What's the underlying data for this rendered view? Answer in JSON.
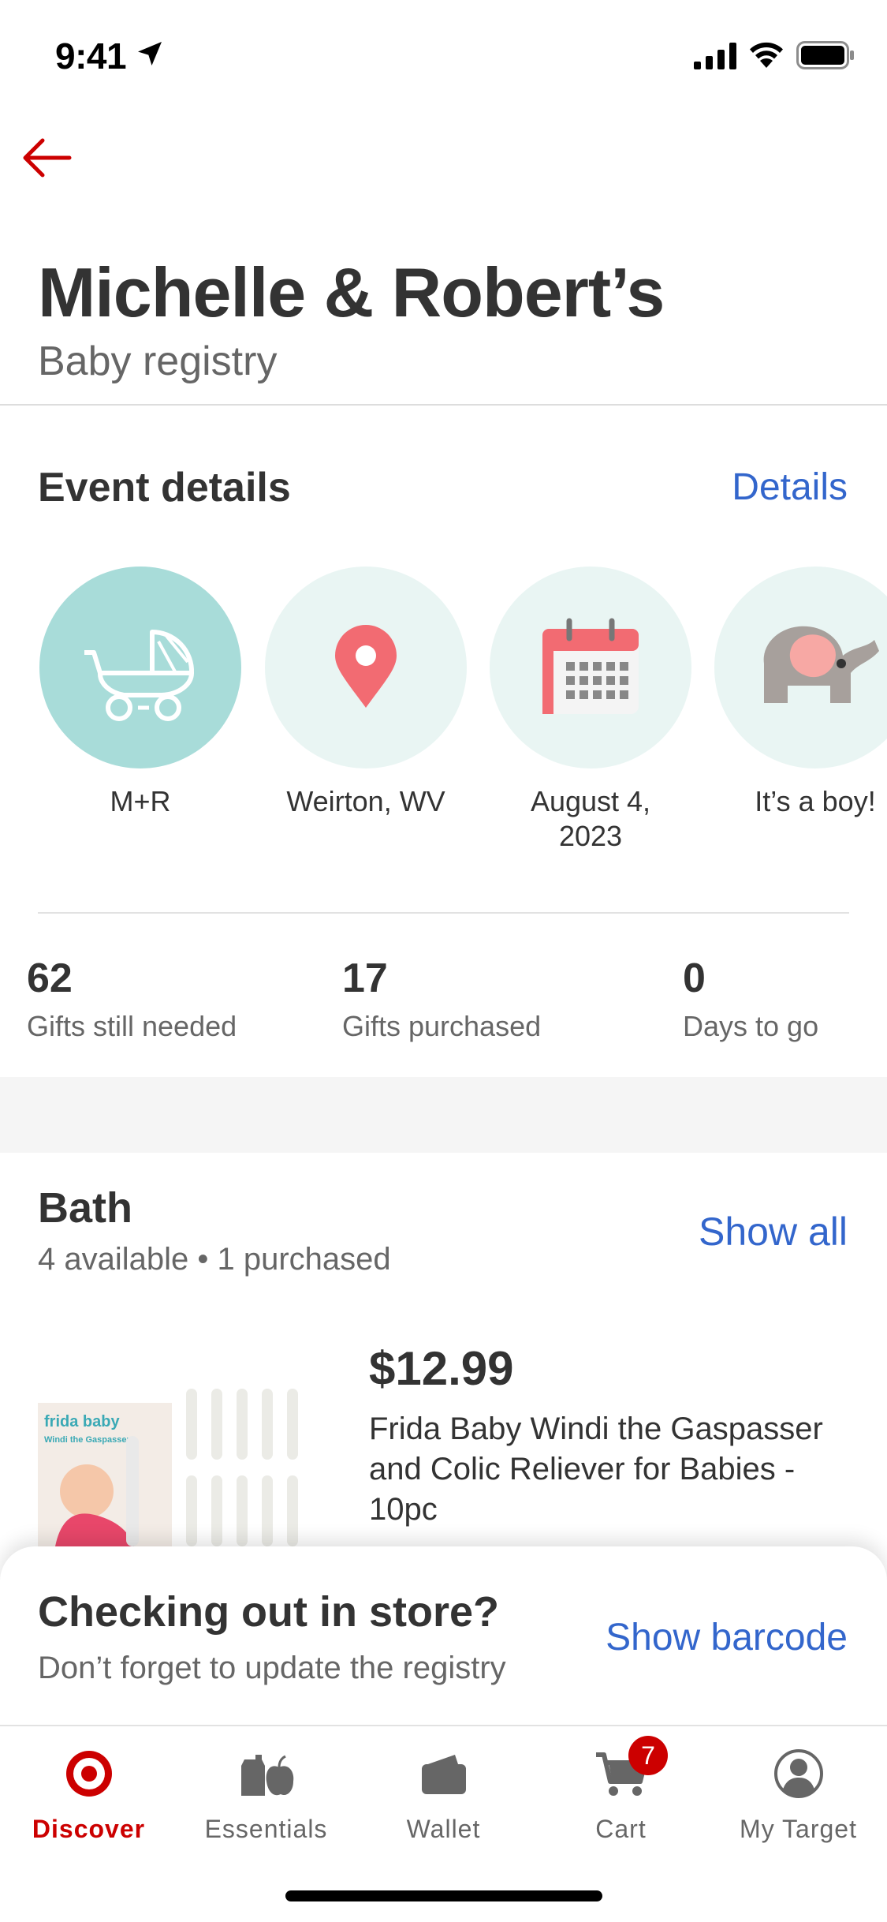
{
  "status": {
    "time": "9:41"
  },
  "header": {
    "title": "Michelle & Robert’s",
    "subtitle": "Baby registry"
  },
  "event": {
    "title": "Event details",
    "details_link": "Details",
    "items": [
      {
        "label": "M+R",
        "icon": "stroller-icon"
      },
      {
        "label": "Weirton, WV",
        "icon": "location-pin-icon"
      },
      {
        "label": "August 4, 2023",
        "icon": "calendar-icon"
      },
      {
        "label": "It’s a boy!",
        "icon": "elephant-icon"
      }
    ]
  },
  "stats": [
    {
      "value": "62",
      "label": "Gifts still needed"
    },
    {
      "value": "17",
      "label": "Gifts purchased"
    },
    {
      "value": "0",
      "label": "Days to go"
    }
  ],
  "category": {
    "title": "Bath",
    "subtitle": "4 available • 1 purchased",
    "show_all": "Show all"
  },
  "product": {
    "price": "$12.99",
    "name": "Frida Baby Windi the Gaspasser and Colic Reliever for Babies - 10pc",
    "image_brand": "frida baby",
    "image_title": "Windi the Gaspasser"
  },
  "sheet": {
    "title": "Checking out in store?",
    "subtitle": "Don’t forget to update the registry",
    "action": "Show barcode"
  },
  "tabs": [
    {
      "label": "Discover",
      "icon": "target-bullseye-icon",
      "active": true
    },
    {
      "label": "Essentials",
      "icon": "essentials-icon"
    },
    {
      "label": "Wallet",
      "icon": "wallet-icon"
    },
    {
      "label": "Cart",
      "icon": "cart-icon",
      "badge": "7"
    },
    {
      "label": "My Target",
      "icon": "account-icon"
    }
  ],
  "colors": {
    "accent_red": "#cc0000",
    "link_blue": "#3366cc",
    "teal": "#a8dcd9",
    "mint": "#e9f5f3",
    "coral": "#f26b72"
  }
}
